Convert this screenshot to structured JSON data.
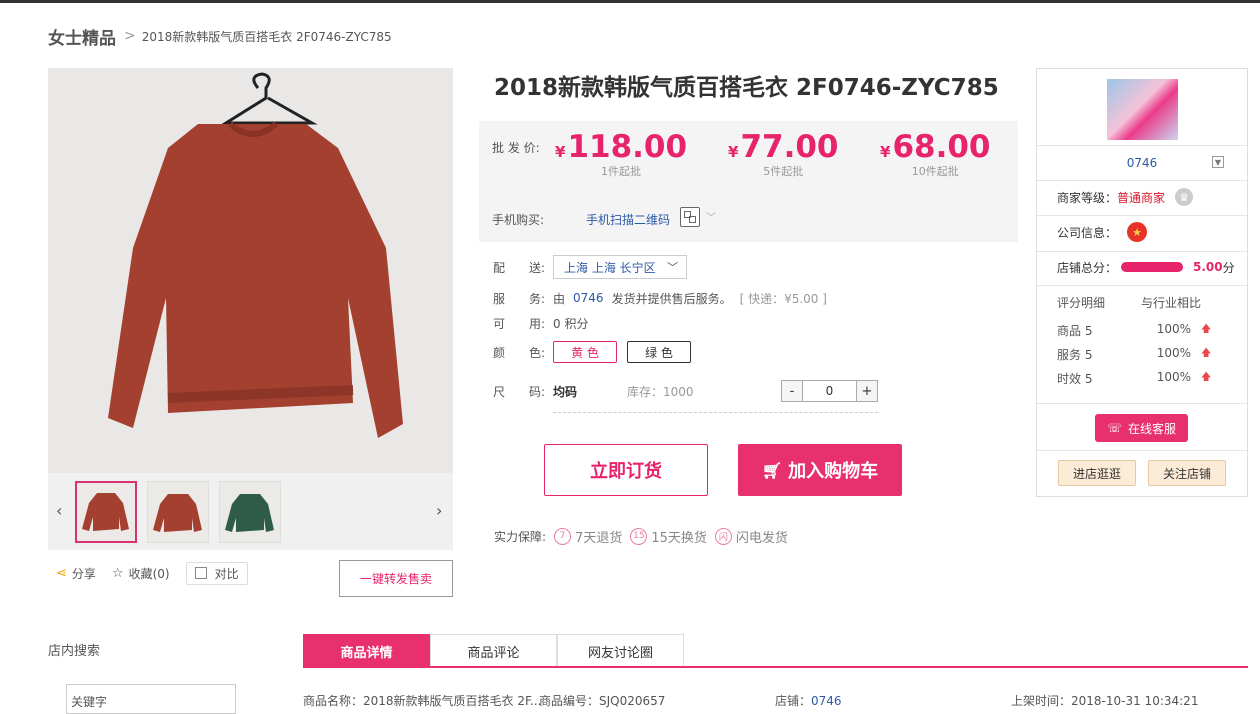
{
  "breadcrumb": {
    "category": "女士精品",
    "separator": ">",
    "product": "2018新款韩版气质百搭毛衣 2F0746-ZYC785"
  },
  "product": {
    "title": "2018新款韩版气质百搭毛衣 2F0746-ZYC785"
  },
  "price": {
    "label": "批 发 价:",
    "currency": "¥",
    "tiers": [
      {
        "amount": "118.00",
        "min": "1件起批"
      },
      {
        "amount": "77.00",
        "min": "5件起批"
      },
      {
        "amount": "68.00",
        "min": "10件起批"
      }
    ],
    "mobile_label": "手机购买:",
    "mobile_link": "手机扫描二维码"
  },
  "shipping": {
    "label": "配　　送:",
    "location": "上海 上海 长宁区"
  },
  "service": {
    "label": "服　　务:",
    "prefix": "由",
    "shop": "0746",
    "text": "发货并提供售后服务。",
    "express": "[ 快递：¥5.00 ]"
  },
  "credit": {
    "label": "可　　用:",
    "value": "0 积分"
  },
  "color": {
    "label": "颜　　色:",
    "options": [
      "黄 色",
      "绿 色"
    ],
    "selected": "黄 色"
  },
  "size": {
    "label": "尺　　码:",
    "value": "均码",
    "stock": "库存：1000"
  },
  "quantity": {
    "minus": "-",
    "value": "0",
    "plus": "+"
  },
  "actions": {
    "order": "立即订货",
    "cart": "加入购物车"
  },
  "guarantee": {
    "label": "实力保障:",
    "items": [
      {
        "icon": "7",
        "text": "7天退货"
      },
      {
        "icon": "15",
        "text": "15天换货"
      },
      {
        "icon": "闪",
        "text": "闪电发货"
      }
    ]
  },
  "gallery_actions": {
    "share": "分享",
    "favorite": "收藏(0)",
    "compare": "对比",
    "forward": "一键转发售卖"
  },
  "shop": {
    "name": "0746",
    "level_label": "商家等级：",
    "level": "普通商家",
    "company_label": "公司信息：",
    "score_label": "店铺总分：",
    "score": "5.00",
    "score_unit": "分",
    "detail_header": "评分明细",
    "compare_header": "与行业相比",
    "ratings": [
      {
        "name": "商品",
        "score": "5",
        "pct": "100%"
      },
      {
        "name": "服务",
        "score": "5",
        "pct": "100%"
      },
      {
        "name": "时效",
        "score": "5",
        "pct": "100%"
      }
    ],
    "cs_button": "在线客服",
    "visit_button": "进店逛逛",
    "follow_button": "关注店铺"
  },
  "sidebar": {
    "title": "店内搜索",
    "keyword_placeholder": "关键字"
  },
  "tabs": [
    "商品详情",
    "商品评论",
    "网友讨论圈"
  ],
  "details": {
    "name": "商品名称：2018新款韩版气质百搭毛衣 2F...",
    "code": "商品编号：SJQ020657",
    "shop_label": "店铺：",
    "shop": "0746",
    "time": "上架时间：2018-10-31 10:34:21"
  },
  "colors": {
    "accent": "#e9306f",
    "link": "#2d5aa6"
  }
}
